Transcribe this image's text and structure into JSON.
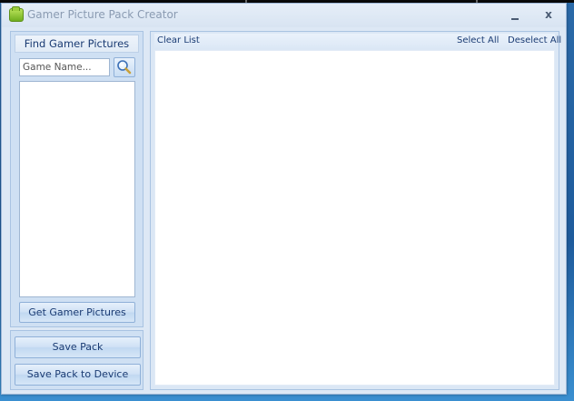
{
  "window": {
    "title": "Gamer Picture Pack Creator"
  },
  "find_panel": {
    "header": "Find Gamer Pictures",
    "search_placeholder": "Game Name...",
    "get_button": "Get Gamer Pictures"
  },
  "actions": {
    "save_pack": "Save Pack",
    "save_pack_device": "Save Pack to Device"
  },
  "toolbar": {
    "clear_list": "Clear List",
    "select_all": "Select All",
    "deselect_all": "Deselect All"
  },
  "icons": {
    "app": "folder-icon",
    "search": "magnifier-icon",
    "minimize": "minimize-icon",
    "close": "close-icon"
  },
  "colors": {
    "accent_text": "#1a3b73",
    "panel_bg": "#cfe0f3",
    "app_icon": "#8cc43a"
  }
}
